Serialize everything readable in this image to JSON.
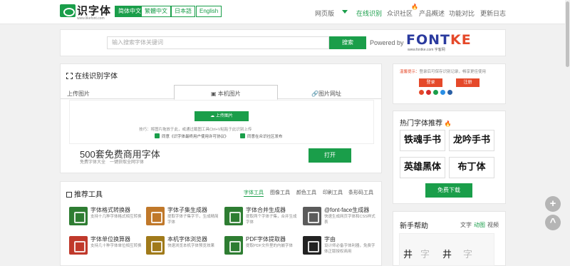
{
  "header": {
    "logo_text": "识字体",
    "logo_sub": "www.likefont.com",
    "languages": [
      "简体中文",
      "繁體中文",
      "日本語",
      "English"
    ],
    "nav": [
      "网页版",
      "在线识别",
      "众识社区",
      "产品概述",
      "功能对比",
      "更新日志"
    ]
  },
  "search": {
    "placeholder": "输入搜索字体关键词",
    "button": "搜索",
    "powered": "Powered by",
    "brand_a": "FONT",
    "brand_b": "KE",
    "brand_sub": "www.fontke.com 字客网"
  },
  "recognize": {
    "title": "在线识别字体",
    "tabs": [
      "上传图片",
      "本机图片",
      "图片网址"
    ],
    "upload_button": "上传图片",
    "tip": "技巧：将图片拖放于此，或通过截图工具Ctrl+V粘贴于此识别上传",
    "agree1": "同意《识字体最终用户使用许可协议》",
    "agree2": "同意在众识社区发布",
    "promo_big": "500套免费商用字体",
    "promo_small": "免费字体大全　一键获取全网字体",
    "open_button": "打开"
  },
  "tools": {
    "title": "推荐工具",
    "tabs": [
      "字体工具",
      "图像工具",
      "颜色工具",
      "印刷工具",
      "条形码工具"
    ],
    "items": [
      {
        "title": "字体格式转换器",
        "desc": "支持十几种字体格式相互转换",
        "color": "#2e7d32"
      },
      {
        "title": "字体子集生成器",
        "desc": "提取字体子集字节，生成精简字体",
        "color": "#c0782a"
      },
      {
        "title": "字体合并生成器",
        "desc": "提取两个字体子集，合并生成字体",
        "color": "#2e7d32"
      },
      {
        "title": "@font-face生成器",
        "desc": "快速生成网页字体和CSS样式表",
        "color": "#5b5b5b"
      },
      {
        "title": "字体单位换算器",
        "desc": "支持几十种字体单位相互转换",
        "color": "#c0392b"
      },
      {
        "title": "本机字体浏览器",
        "desc": "快速浏览本机字体预览效果",
        "color": "#a07a1a"
      },
      {
        "title": "PDF字体提取器",
        "desc": "提取PDF文件里的内嵌字体",
        "color": "#2e7d32"
      },
      {
        "title": "字由",
        "desc": "设计师必备字体利器，免费字体正版授权商用",
        "color": "#222222"
      }
    ]
  },
  "account": {
    "hint_prefix": "温馨提示：",
    "hint": "登录后可保存识别记录，畅享更佳使用",
    "login": "登录",
    "register": "注册"
  },
  "hot_fonts": {
    "title": "热门字体推荐",
    "samples": [
      "铁魂手书",
      "龙吟手书",
      "英雄黑体",
      "布丁体"
    ],
    "download": "免费下载"
  },
  "help": {
    "title": "新手帮助",
    "tabs": [
      "文字",
      "动图",
      "视频"
    ],
    "chars": [
      "井",
      "字",
      "井",
      "字"
    ]
  },
  "float": {
    "plus": "+",
    "up": "^"
  },
  "colors": {
    "brand_green": "#1a9e4a",
    "accent_red": "#e5492a"
  }
}
